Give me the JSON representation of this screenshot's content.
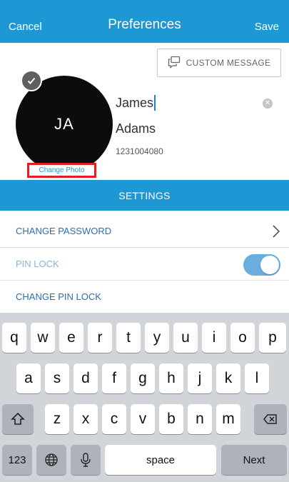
{
  "navbar": {
    "cancel_label": "Cancel",
    "title": "Preferences",
    "save_label": "Save"
  },
  "profile": {
    "custom_message_label": "CUSTOM MESSAGE",
    "initials": "JA",
    "change_photo_label": "Change Photo",
    "first_name": "James",
    "last_name": "Adams",
    "phone": "1231004080"
  },
  "settings": {
    "header": "SETTINGS",
    "items": [
      {
        "label": "CHANGE PASSWORD"
      },
      {
        "label": "PIN LOCK",
        "toggle_on": true
      },
      {
        "label": "CHANGE PIN LOCK"
      }
    ]
  },
  "keyboard": {
    "row1": [
      "q",
      "w",
      "e",
      "r",
      "t",
      "y",
      "u",
      "i",
      "o",
      "p"
    ],
    "row2": [
      "a",
      "s",
      "d",
      "f",
      "g",
      "h",
      "j",
      "k",
      "l"
    ],
    "row3": [
      "z",
      "x",
      "c",
      "v",
      "b",
      "n",
      "m"
    ],
    "numbers_label": "123",
    "space_label": "space",
    "next_label": "Next"
  },
  "colors": {
    "accent": "#1e98d4",
    "highlight_border": "#e02020",
    "toggle_on": "#6aaee0"
  },
  "icons": [
    "message-icon",
    "check-icon",
    "clear-icon",
    "chevron-right-icon",
    "shift-icon",
    "backspace-icon",
    "globe-icon",
    "microphone-icon"
  ]
}
